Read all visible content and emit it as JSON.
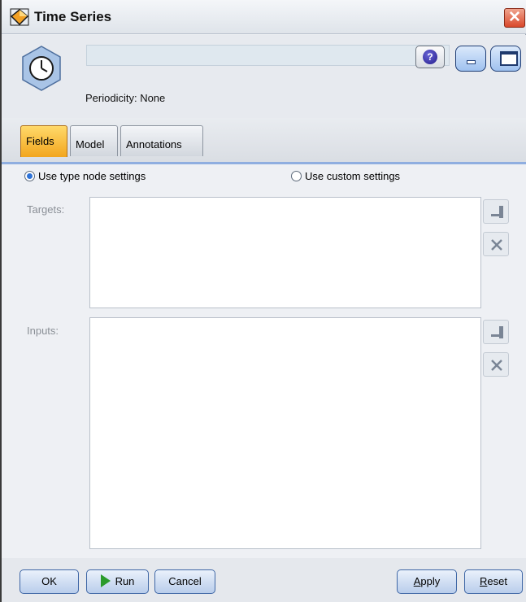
{
  "window": {
    "title": "Time Series",
    "close_glyph": "✕"
  },
  "header": {
    "node_name_value": "",
    "periodicity": "Periodicity: None",
    "help_glyph": "?"
  },
  "tabs": [
    {
      "label": "Fields",
      "active": true
    },
    {
      "label": "Model",
      "active": false
    },
    {
      "label": "Annotations",
      "active": false
    }
  ],
  "fields": {
    "radio_type_node": {
      "label": "Use type node settings",
      "selected": true
    },
    "radio_custom": {
      "label": "Use custom settings",
      "selected": false
    },
    "targets_label": "Targets:",
    "inputs_label": "Inputs:"
  },
  "footer": {
    "ok": "OK",
    "run": "Run",
    "cancel": "Cancel",
    "apply_underline": "A",
    "apply_rest": "pply",
    "reset_underline": "R",
    "reset_rest": "eset"
  },
  "colors": {
    "active_tab": "#f2a61e",
    "tab_rule": "#8faee0",
    "button_border": "#3f67a6",
    "run_arrow": "#2b9b2b",
    "close_red": "#d9482b"
  },
  "icons": {
    "title": "diamond-node-icon",
    "node": "clock-node-icon",
    "help": "help-icon",
    "minimize": "minimize-icon",
    "maximize": "maximize-icon",
    "close": "close-icon",
    "field_picker": "field-picker-icon",
    "remove": "remove-x-icon",
    "run": "run-arrow-icon"
  }
}
